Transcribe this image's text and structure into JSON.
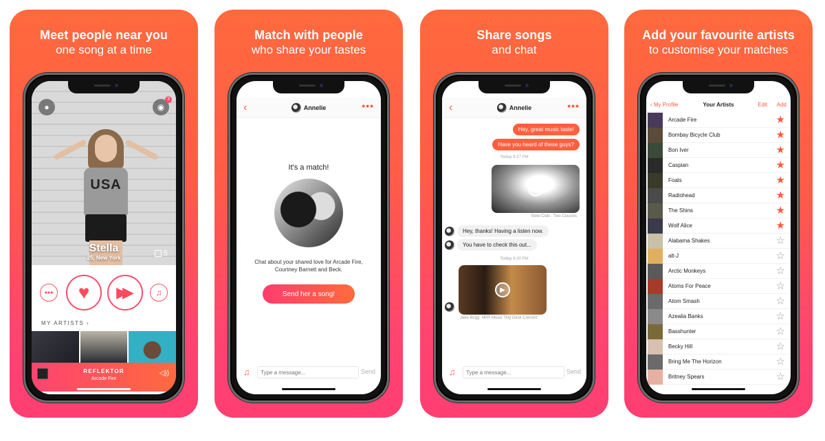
{
  "panels": [
    {
      "caption": {
        "line1": "Meet people near you",
        "line2": "one song at a time"
      },
      "profile": {
        "name": "Stella",
        "subtitle": "25, New York",
        "photo_count": "5",
        "notification_count": "3"
      },
      "my_artists_label": "MY ARTISTS ›",
      "now_playing": {
        "title": "REFLEKTOR",
        "artist": "Arcade Fire"
      },
      "icons": {
        "profile": "●",
        "chat": "●",
        "heart": "♥",
        "skip": "▶▶",
        "more": "•••",
        "music": "♫",
        "volume": "◁))"
      }
    },
    {
      "caption": {
        "line1": "Match with people",
        "line2": "who share your tastes"
      },
      "header": {
        "back": "‹",
        "name": "Annelie",
        "more": "•••"
      },
      "match_title": "It's a match!",
      "match_text": "Chat about your shared love for Arcade Fire, Courtney Barnett and Beck.",
      "cta_label": "Send her a song!",
      "composer": {
        "placeholder": "Type a message...",
        "send": "Send",
        "music_icon": "♫"
      }
    },
    {
      "caption": {
        "line1": "Share songs",
        "line2": "and chat"
      },
      "header": {
        "back": "‹",
        "name": "Annelie",
        "more": "•••"
      },
      "messages": {
        "out1": "Hey, great music taste!",
        "out2": "Have you heard of these guys?",
        "ts1_day": "Today",
        "ts1_time": "6:27 PM",
        "video1_caption": "Slow Club - Two Cousins",
        "in1": "Hey, thanks! Having a listen now.",
        "in2": "You have to check this out...",
        "ts2_day": "Today",
        "ts2_time": "6:30 PM",
        "video2_caption": "Jake Bugg: NPR Music Tiny Desk Concert",
        "play_icon": "▶"
      },
      "composer": {
        "placeholder": "Type a message...",
        "send": "Send",
        "music_icon": "♫"
      }
    },
    {
      "caption": {
        "line1": "Add your favourite artists",
        "line2": "to customise your matches"
      },
      "header": {
        "back": "‹ My Profile",
        "title": "Your Artists",
        "edit": "Edit",
        "add": "Add"
      },
      "artists": [
        {
          "name": "Arcade Fire",
          "favourite": true
        },
        {
          "name": "Bombay Bicycle Club",
          "favourite": true
        },
        {
          "name": "Bon Iver",
          "favourite": true
        },
        {
          "name": "Caspian",
          "favourite": true
        },
        {
          "name": "Foals",
          "favourite": true
        },
        {
          "name": "Radiohead",
          "favourite": true
        },
        {
          "name": "The Shins",
          "favourite": true
        },
        {
          "name": "Wolf Alice",
          "favourite": true
        },
        {
          "name": "Alabama Shakes",
          "favourite": false
        },
        {
          "name": "alt-J",
          "favourite": false
        },
        {
          "name": "Arctic Monkeys",
          "favourite": false
        },
        {
          "name": "Atoms For Peace",
          "favourite": false
        },
        {
          "name": "Atom Smash",
          "favourite": false
        },
        {
          "name": "Azealia Banks",
          "favourite": false
        },
        {
          "name": "Basshunter",
          "favourite": false
        },
        {
          "name": "Becky Hill",
          "favourite": false
        },
        {
          "name": "Bring Me The Horizon",
          "favourite": false
        },
        {
          "name": "Britney Spears",
          "favourite": false
        }
      ]
    }
  ],
  "colors": {
    "accent": "#ff5a3c",
    "gradient_top": "#ff6a3d",
    "gradient_bottom": "#ff3e72"
  }
}
